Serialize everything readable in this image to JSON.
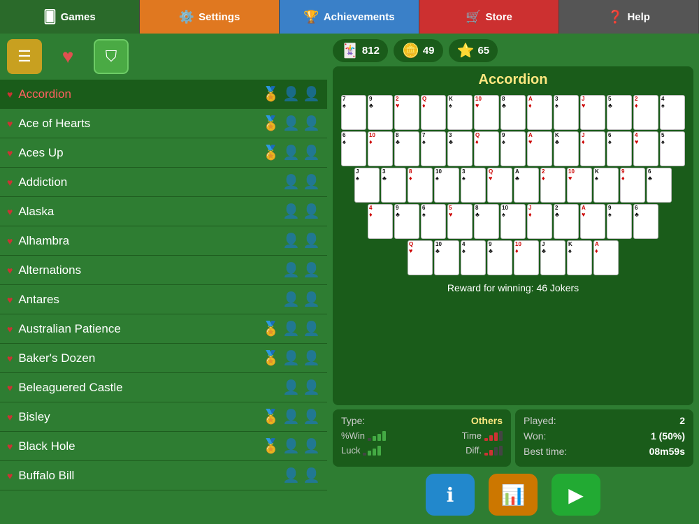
{
  "nav": {
    "items": [
      {
        "id": "games",
        "label": "Games",
        "icon": "🂠",
        "class": "games"
      },
      {
        "id": "settings",
        "label": "Settings",
        "icon": "⚙️",
        "class": "settings"
      },
      {
        "id": "achievements",
        "label": "Achievements",
        "icon": "🏆",
        "class": "achievements"
      },
      {
        "id": "store",
        "label": "Store",
        "icon": "🛒",
        "class": "store"
      },
      {
        "id": "help",
        "label": "Help",
        "icon": "❓",
        "class": "help"
      }
    ]
  },
  "stats": {
    "jokers": "812",
    "coins": "49",
    "stars": "65"
  },
  "filter": {
    "list_icon": "≡",
    "heart_icon": "♥",
    "funnel_icon": "▽"
  },
  "game_list": [
    {
      "name": "Accordion",
      "highlight": true
    },
    {
      "name": "Ace of Hearts",
      "highlight": false
    },
    {
      "name": "Aces Up",
      "highlight": false
    },
    {
      "name": "Addiction",
      "highlight": false
    },
    {
      "name": "Alaska",
      "highlight": false
    },
    {
      "name": "Alhambra",
      "highlight": false
    },
    {
      "name": "Alternations",
      "highlight": false
    },
    {
      "name": "Antares",
      "highlight": false
    },
    {
      "name": "Australian Patience",
      "highlight": false
    },
    {
      "name": "Baker's Dozen",
      "highlight": false
    },
    {
      "name": "Beleaguered Castle",
      "highlight": false
    },
    {
      "name": "Bisley",
      "highlight": false
    },
    {
      "name": "Black Hole",
      "highlight": false
    },
    {
      "name": "Buffalo Bill",
      "highlight": false
    }
  ],
  "preview": {
    "title": "Accordion",
    "reward_text": "Reward for winning: 46 Jokers"
  },
  "game_info": {
    "type_label": "Type:",
    "type_value": "Others",
    "win_label": "%Win",
    "time_label": "Time",
    "luck_label": "Luck",
    "diff_label": "Diff.",
    "played_label": "Played:",
    "played_value": "2",
    "won_label": "Won:",
    "won_value": "1 (50%)",
    "best_time_label": "Best time:",
    "best_time_value": "08m59s"
  },
  "buttons": {
    "info": "ℹ",
    "chart": "📊",
    "play": "▶"
  },
  "colors": {
    "green_dark": "#1a5c1a",
    "green_mid": "#2e7d32",
    "green_light": "#3a8c3a",
    "accent_yellow": "#ffe880",
    "accent_red": "#cc3333"
  }
}
